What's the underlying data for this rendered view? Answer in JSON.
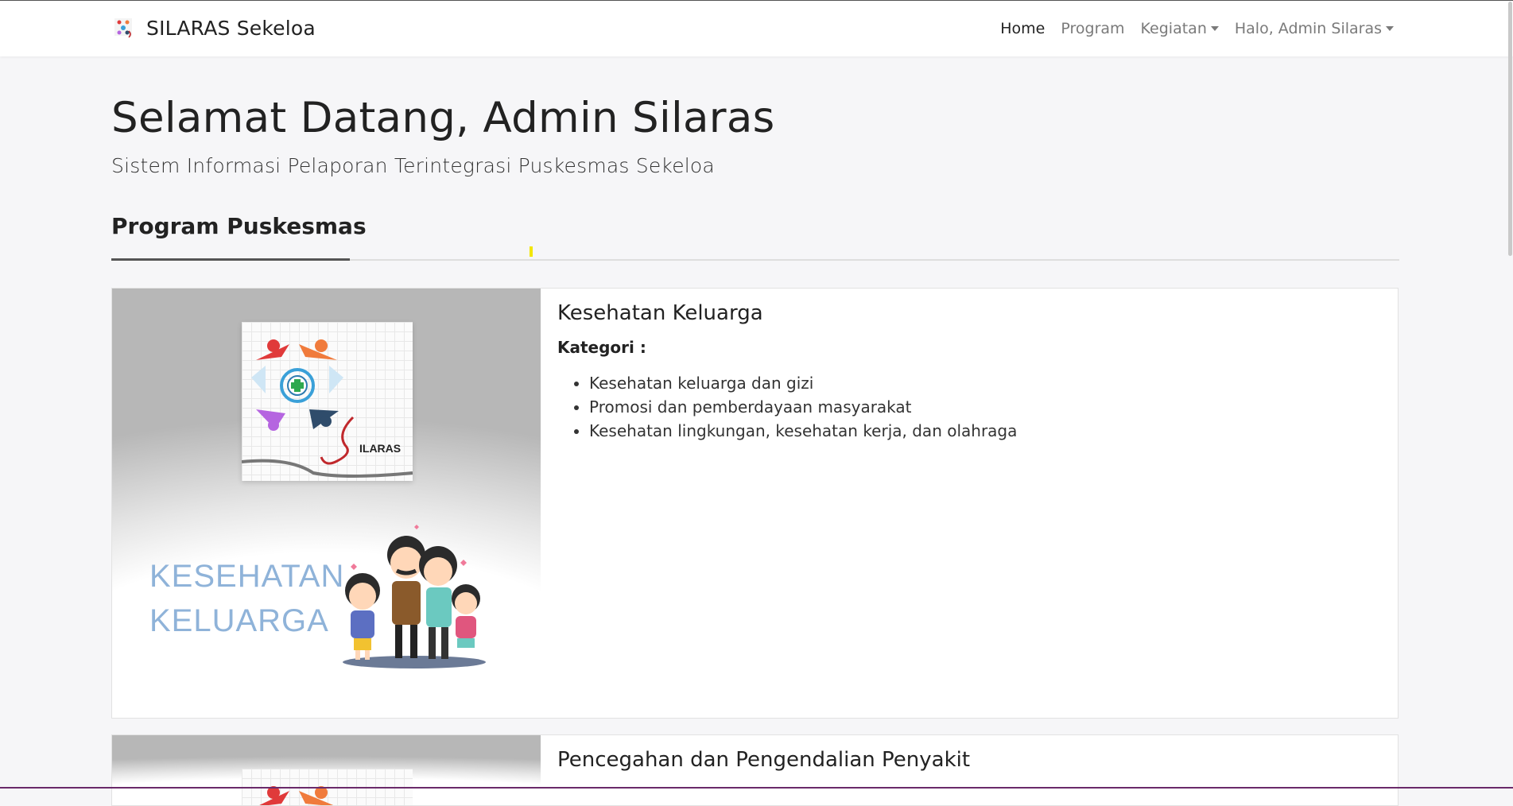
{
  "navbar": {
    "brand": "SILARAS Sekeloa",
    "items": [
      {
        "label": "Home",
        "active": true,
        "dropdown": false
      },
      {
        "label": "Program",
        "active": false,
        "dropdown": false
      },
      {
        "label": "Kegiatan",
        "active": false,
        "dropdown": true
      },
      {
        "label": "Halo, Admin Silaras",
        "active": false,
        "dropdown": true
      }
    ]
  },
  "hero": {
    "title": "Selamat Datang, Admin Silaras",
    "subtitle": "Sistem Informasi Pelaporan Terintegrasi Puskesmas Sekeloa"
  },
  "section": {
    "title": "Program Puskesmas"
  },
  "programs": [
    {
      "title": "Kesehatan Keluarga",
      "kategori_label": "Kategori :",
      "image_logo_text": "ILARAS",
      "image_caption_line1": "KESEHATAN",
      "image_caption_line2": "KELUARGA",
      "categories": [
        "Kesehatan keluarga dan gizi",
        "Promosi dan pemberdayaan masyarakat",
        "Kesehatan lingkungan, kesehatan kerja, dan olahraga"
      ]
    },
    {
      "title": "Pencegahan dan Pengendalian Penyakit"
    }
  ],
  "colors": {
    "background": "#f6f6f8",
    "caption": "#8fb3d9",
    "accent_mark": "#f2e600"
  }
}
